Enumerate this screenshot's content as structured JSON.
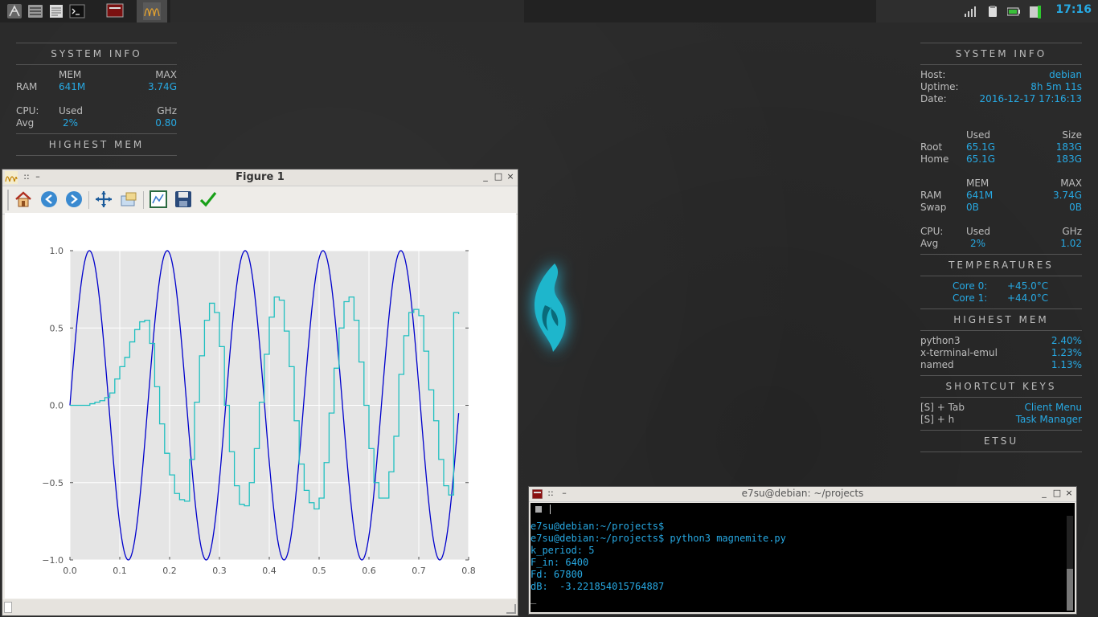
{
  "panel": {
    "clock": "17:16",
    "launchers": [
      "menu-icon",
      "file-manager-icon",
      "text-editor-icon",
      "terminal-icon"
    ],
    "tasks": [
      "terminal-task-icon",
      "matplotlib-figure-task-icon"
    ],
    "tray": [
      "signal-icon",
      "clipboard-icon",
      "battery-icon",
      "network-icon"
    ]
  },
  "conky_left": {
    "section1": "SYSTEM INFO",
    "mem_hdr": "MEM",
    "max_hdr": "MAX",
    "ram_label": "RAM",
    "ram_used": "641M",
    "ram_max": "3.74G",
    "cpu_label": "CPU:",
    "used_hdr": "Used",
    "ghz_hdr": "GHz",
    "avg_label": "Avg",
    "cpu_pct": "2%",
    "cpu_ghz": "0.80",
    "section2": "HIGHEST MEM"
  },
  "conky_right": {
    "section1": "SYSTEM INFO",
    "host_label": "Host:",
    "host": "debian",
    "uptime_label": "Uptime:",
    "uptime": "8h 5m 11s",
    "date_label": "Date:",
    "date": "2016-12-17 17:16:13",
    "used_hdr": "Used",
    "size_hdr": "Size",
    "root_label": "Root",
    "root_used": "65.1G",
    "root_size": "183G",
    "home_label": "Home",
    "home_used": "65.1G",
    "home_size": "183G",
    "mem_hdr": "MEM",
    "max_hdr": "MAX",
    "ram_label": "RAM",
    "ram_used": "641M",
    "ram_max": "3.74G",
    "swap_label": "Swap",
    "swap_used": "0B",
    "swap_max": "0B",
    "cpu_label": "CPU:",
    "cpu_used_hdr": "Used",
    "ghz_hdr": "GHz",
    "avg_label": "Avg",
    "cpu_pct": "2%",
    "cpu_ghz": "1.02",
    "section2": "TEMPERATURES",
    "core0_label": "Core 0:",
    "core0": "+45.0°C",
    "core1_label": "Core 1:",
    "core1": "+44.0°C",
    "section3": "HIGHEST MEM",
    "procs": [
      {
        "name": "python3",
        "pct": "2.40%"
      },
      {
        "name": "x-terminal-emul",
        "pct": "1.23%"
      },
      {
        "name": "named",
        "pct": "1.13%"
      }
    ],
    "section4": "SHORTCUT KEYS",
    "keys": [
      {
        "combo": "[S] + Tab",
        "action": "Client Menu"
      },
      {
        "combo": "[S] + h",
        "action": "Task Manager"
      }
    ],
    "section5": "ETSU"
  },
  "figure_window": {
    "title": "Figure 1",
    "minimize": "_",
    "maximize": "□",
    "close": "×",
    "toolbar": [
      "home-icon",
      "back-icon",
      "forward-icon",
      "pan-icon",
      "zoom-icon",
      "subplots-icon",
      "save-icon",
      "edit-icon"
    ]
  },
  "terminal": {
    "title": "e7su@debian: ~/projects",
    "lines": [
      "e7su@debian:~/projects$",
      "e7su@debian:~/projects$ python3 magnemite.py",
      "k_period: 5",
      "F_in: 6400",
      "Fd: 67800",
      "dB:  -3.221854015764887",
      "_"
    ]
  },
  "chart_data": {
    "type": "line",
    "xlim": [
      0.0,
      0.8
    ],
    "ylim": [
      -1.0,
      1.0
    ],
    "xticks": [
      "0.0",
      "0.1",
      "0.2",
      "0.3",
      "0.4",
      "0.5",
      "0.6",
      "0.7",
      "0.8"
    ],
    "yticks": [
      "1.0",
      "0.5",
      "0.0",
      "−0.5",
      "−1.0"
    ],
    "grid": true,
    "series": [
      {
        "color": "#0000cc",
        "style": "sine",
        "frequency": 6.4,
        "amplitude": 1.0,
        "x_end": 0.78
      },
      {
        "color": "#20c0c0",
        "style": "step",
        "x": [
          0.0,
          0.04,
          0.05,
          0.06,
          0.07,
          0.08,
          0.09,
          0.1,
          0.11,
          0.12,
          0.13,
          0.14,
          0.15,
          0.16,
          0.17,
          0.18,
          0.19,
          0.2,
          0.21,
          0.22,
          0.23,
          0.24,
          0.25,
          0.26,
          0.27,
          0.28,
          0.29,
          0.3,
          0.31,
          0.32,
          0.33,
          0.34,
          0.35,
          0.36,
          0.37,
          0.38,
          0.39,
          0.4,
          0.41,
          0.42,
          0.43,
          0.44,
          0.45,
          0.46,
          0.47,
          0.48,
          0.49,
          0.5,
          0.51,
          0.52,
          0.53,
          0.54,
          0.55,
          0.56,
          0.57,
          0.58,
          0.59,
          0.6,
          0.61,
          0.62,
          0.63,
          0.64,
          0.65,
          0.66,
          0.67,
          0.68,
          0.69,
          0.7,
          0.71,
          0.72,
          0.73,
          0.74,
          0.75,
          0.76,
          0.77,
          0.78
        ],
        "y": [
          0.0,
          0.01,
          0.02,
          0.03,
          0.05,
          0.08,
          0.17,
          0.25,
          0.31,
          0.41,
          0.49,
          0.54,
          0.55,
          0.4,
          0.12,
          -0.12,
          -0.31,
          -0.45,
          -0.57,
          -0.61,
          -0.62,
          -0.35,
          0.02,
          0.32,
          0.55,
          0.66,
          0.6,
          0.38,
          0.0,
          -0.3,
          -0.52,
          -0.64,
          -0.65,
          -0.5,
          -0.28,
          0.02,
          0.33,
          0.57,
          0.7,
          0.68,
          0.48,
          0.25,
          -0.1,
          -0.38,
          -0.55,
          -0.63,
          -0.67,
          -0.6,
          -0.37,
          -0.05,
          0.24,
          0.5,
          0.67,
          0.7,
          0.55,
          0.28,
          0.0,
          -0.28,
          -0.5,
          -0.6,
          -0.6,
          -0.43,
          -0.2,
          0.2,
          0.45,
          0.6,
          0.62,
          0.58,
          0.35,
          0.1,
          -0.1,
          -0.35,
          -0.52,
          -0.58,
          0.6,
          0.59
        ]
      }
    ]
  }
}
